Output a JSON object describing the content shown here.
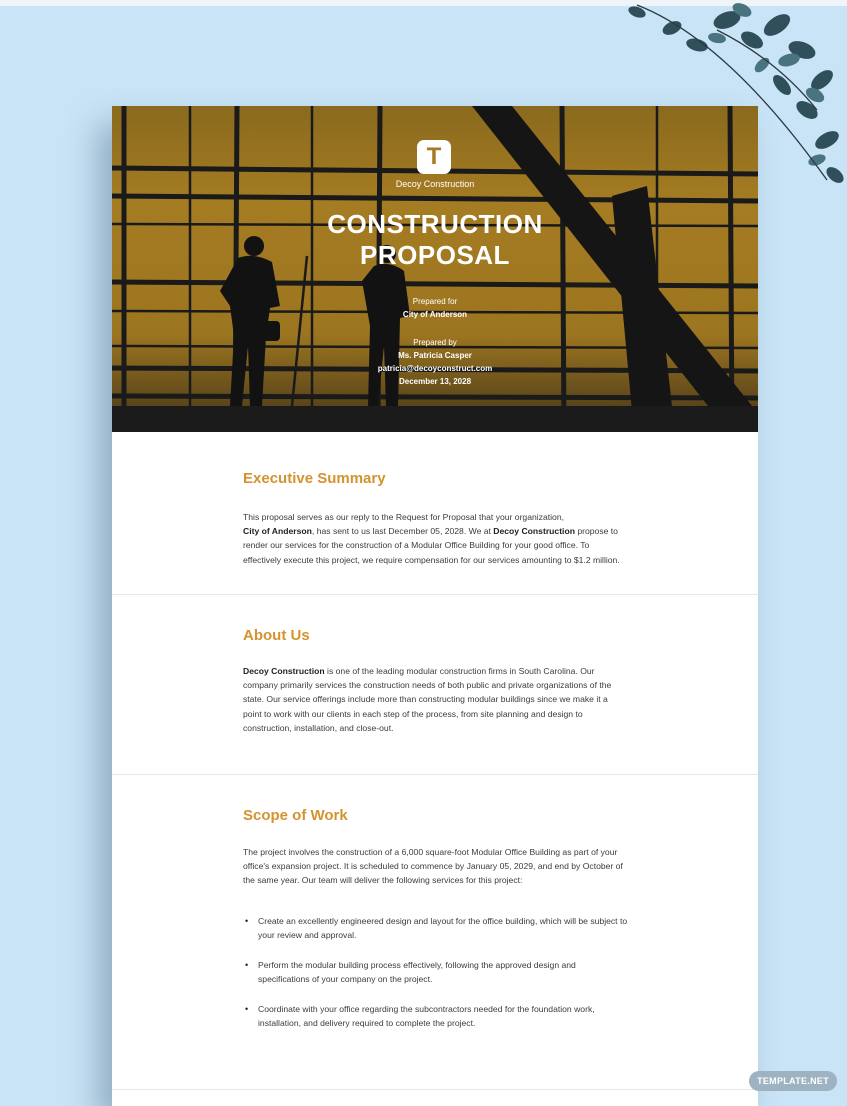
{
  "header": {
    "logo_letter": "T",
    "company": "Decoy Construction",
    "title_line1": "CONSTRUCTION",
    "title_line2": "PROPOSAL",
    "prepared_for_label": "Prepared for",
    "prepared_for_name": "City of Anderson",
    "prepared_by_label": "Prepared by",
    "prepared_by_name": "Ms. Patricia Casper",
    "email": "patricia@decoyconstruct.com",
    "date": "December 13, 2028"
  },
  "executive_summary": {
    "heading": "Executive Summary",
    "p1": "This proposal serves as our reply to the Request for Proposal that your organization,",
    "org": "City of Anderson",
    "p2": ", has sent to us last December 05, 2028. We at ",
    "company": "Decoy Construction",
    "p3": " propose to render our services for the construction of a Modular Office Building for your good office. To effectively execute this project, we require compensation for our services amounting to $1.2 million."
  },
  "about_us": {
    "heading": "About Us",
    "company": "Decoy Construction",
    "text": " is one of the leading modular construction firms in South Carolina. Our company primarily services the construction needs of both public and private organizations of the state. Our service offerings include more than constructing modular buildings since we make it a point to work with our clients in each step of the process, from site planning and design to construction, installation, and close-out."
  },
  "scope_of_work": {
    "heading": "Scope of Work",
    "intro": "The project involves the construction of a 6,000 square-foot Modular Office Building as part of your office's expansion project. It is scheduled to commence by January 05, 2029, and end by October of the same year. Our team will deliver the following services for this project:",
    "bullets": [
      "Create an excellently engineered design and layout for the office building, which will be subject to your review and approval.",
      "Perform the modular building process effectively, following the approved design and specifications of your company on the project.",
      "Coordinate with your office regarding the subcontractors needed for the foundation work, installation, and delivery required to complete the project."
    ]
  },
  "watermark": "TEMPLATE.NET",
  "colors": {
    "accent": "#d4932e",
    "background": "#c9e4f6",
    "hero": "#a57c22"
  }
}
